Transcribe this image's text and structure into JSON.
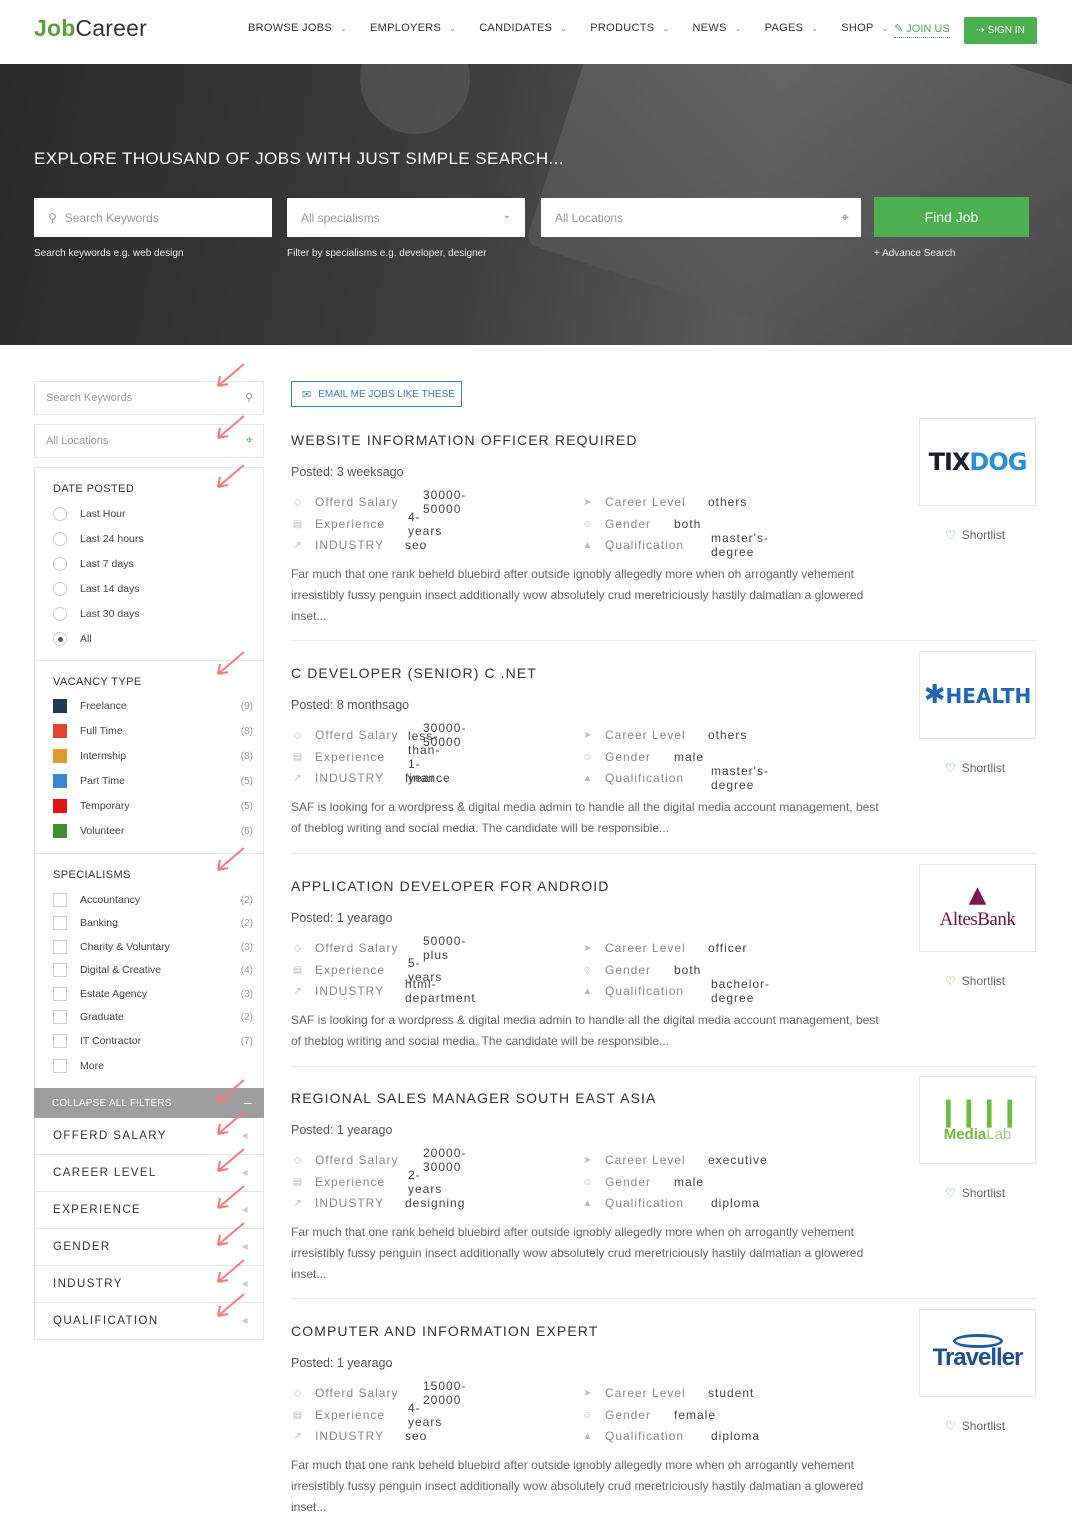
{
  "header": {
    "logo_part1": "Job",
    "logo_part2": "Career",
    "nav": [
      "BROWSE JOBS",
      "EMPLOYERS",
      "CANDIDATES",
      "PRODUCTS",
      "NEWS",
      "PAGES",
      "SHOP"
    ],
    "join_label": "JOIN US",
    "signin_label": "SIGN IN"
  },
  "hero": {
    "title": "EXPLORE THOUSAND OF JOBS WITH JUST SIMPLE SEARCH...",
    "keywords_placeholder": "Search Keywords",
    "specialisms_placeholder": "All specialisms",
    "locations_placeholder": "All Locations",
    "find_label": "Find Job",
    "hint_keywords": "Search keywords e.g. web design",
    "hint_specialisms": "Filter by specialisms e.g. developer, designer",
    "advance_search": "+ Advance Search"
  },
  "sidebar": {
    "search_placeholder": "Search Keywords",
    "location_placeholder": "All Locations",
    "date_posted": {
      "title": "DATE POSTED",
      "options": [
        "Last Hour",
        "Last 24 hours",
        "Last 7 days",
        "Last 14 days",
        "Last 30 days",
        "All"
      ],
      "selected": "All"
    },
    "vacancy_type": {
      "title": "VACANCY TYPE",
      "items": [
        {
          "label": "Freelance",
          "count": "(9)",
          "color": "#1f3a5a"
        },
        {
          "label": "Full Time",
          "count": "(8)",
          "color": "#e2432f"
        },
        {
          "label": "Internship",
          "count": "(8)",
          "color": "#e09a2c"
        },
        {
          "label": "Part Time",
          "count": "(5)",
          "color": "#3b86d4"
        },
        {
          "label": "Temporary",
          "count": "(5)",
          "color": "#e01414"
        },
        {
          "label": "Volunteer",
          "count": "(6)",
          "color": "#3f8f2f"
        }
      ]
    },
    "specialisms": {
      "title": "SPECIALISMS",
      "items": [
        {
          "label": "Accountancy",
          "count": "(2)"
        },
        {
          "label": "Banking",
          "count": "(2)"
        },
        {
          "label": "Charity & Voluntary",
          "count": "(3)"
        },
        {
          "label": "Digital & Creative",
          "count": "(4)"
        },
        {
          "label": "Estate Agency",
          "count": "(3)"
        },
        {
          "label": "Graduate",
          "count": "(2)"
        },
        {
          "label": "IT Contractor",
          "count": "(7)"
        },
        {
          "label": "More",
          "count": ""
        }
      ]
    },
    "collapse_label": "COLLAPSE ALL FILTERS",
    "collapsed_filters": [
      "OFFERD SALARY",
      "CAREER LEVEL",
      "EXPERIENCE",
      "GENDER",
      "INDUSTRY",
      "QUALIFICATION"
    ]
  },
  "main": {
    "email_label": "EMAIL ME JOBS LIKE THESE",
    "shortlist_label": "Shortlist",
    "spec_labels": {
      "salary": "Offerd Salary",
      "experience": "Experience",
      "industry": "INDUSTRY",
      "career": "Career Level",
      "gender": "Gender",
      "qualification": "Qualification"
    },
    "jobs": [
      {
        "title": "WEBSITE INFORMATION OFFICER REQUIRED",
        "posted": "Posted: 3 weeksago",
        "salary": "30000-50000",
        "experience": "4-years",
        "industry": "seo",
        "career": "others",
        "gender": "both",
        "qualification": "master's-degree",
        "desc": "Far much that one rank beheld bluebird after outside ignobly allegedly more when oh arrogantly vehement irresistibly fussy penguin insect additionally wow absolutely crud meretriciously hastily dalmatian a glowered inset...",
        "company": "TIXDOG"
      },
      {
        "title": "C DEVELOPER (SENIOR) C .NET",
        "posted": "Posted: 8 monthsago",
        "salary": "30000-50000",
        "experience": "less-than-1-year",
        "industry": "finance",
        "career": "others",
        "gender": "male",
        "qualification": "master's-degree",
        "desc": "SAF is looking for a wordpress & digital media admin to handle all the digital media account management, best of theblog writing and social media. The candidate will be responsible...",
        "company": "HEALTH"
      },
      {
        "title": "APPLICATION DEVELOPER FOR ANDROID",
        "posted": "Posted: 1 yearago",
        "salary": "50000-plus",
        "experience": "5-years",
        "industry": "html-department",
        "career": "officer",
        "gender": "both",
        "qualification": "bachelor-degree",
        "desc": "SAF is looking for a wordpress & digital media admin to handle all the digital media account management, best of theblog writing and social media. The candidate will be responsible...",
        "company": "AltesBank"
      },
      {
        "title": "REGIONAL SALES MANAGER SOUTH EAST ASIA",
        "posted": "Posted: 1 yearago",
        "salary": "20000-30000",
        "experience": "2-years",
        "industry": "designing",
        "career": "executive",
        "gender": "male",
        "qualification": "diploma",
        "desc": "Far much that one rank beheld bluebird after outside ignobly allegedly more when oh arrogantly vehement irresistibly fussy penguin insect additionally wow absolutely crud meretriciously hastily dalmatian a glowered inset...",
        "company_part1": "Media",
        "company_part2": "Lab"
      },
      {
        "title": "COMPUTER AND INFORMATION EXPERT",
        "posted": "Posted: 1 yearago",
        "salary": "15000-20000",
        "experience": "4-years",
        "industry": "seo",
        "career": "student",
        "gender": "female",
        "qualification": "diploma",
        "desc": "Far much that one rank beheld bluebird after outside ignobly allegedly more when oh arrogantly vehement irresistibly fussy penguin insect additionally wow absolutely crud meretriciously hastily dalmatian a glowered inset...",
        "company": "Traveller"
      }
    ]
  }
}
